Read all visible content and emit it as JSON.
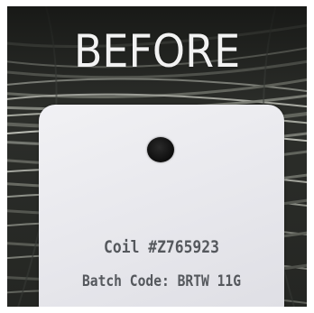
{
  "caption": "BEFORE",
  "tag": {
    "coil": "Coil #Z765923",
    "batch": "Batch Code: BRTW 11G"
  },
  "colors": {
    "background": "#2b2d2a",
    "tag": "#e9e9ee",
    "tag_text": "#55585d",
    "caption_text": "#f2f2f2"
  }
}
